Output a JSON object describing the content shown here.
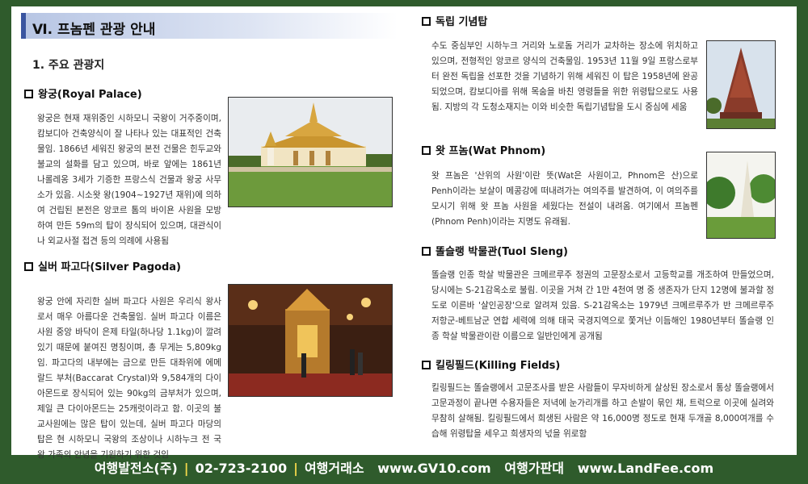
{
  "section_title": "Ⅵ. 프놈펜 관광 안내",
  "subheading": "1. 주요 관광지",
  "left": {
    "royal_palace": {
      "title": "왕궁(Royal Palace)",
      "text": "왕궁은 현재 재위중인 시하모니 국왕이 거주중이며, 캄보디아 건축양식이 잘 나타나 있는 대표적인 건축물임. 1866년 세워진 왕궁의 본전 건물은 힌두교와 불교의 설화를 담고 있으며, 바로 앞에는 1861년 나롤레옹 3세가 기증한 프랑스식 건물과 왕궁 사무소가 있음. 시소왓 왕(1904~1927년 재위)에 의하여 건립된 본전은 앙코르 톰의 바이욘 사원을 모방하여 만든 59m의 탑이 장식되어 있으며, 대관식이나 외교사절 접견 등의 의례에 사용됨"
    },
    "silver_pagoda": {
      "title": "실버 파고다(Silver Pagoda)",
      "text": "왕궁 안에 자리한 실버 파고다 사원은 우리식 왕사로서 매우 아름다운 건축물임. 실버 파고다 이름은 사원 중앙 바닥이 은제 타일(하나당 1.1kg)이 깔려있기 때문에 붙여진 명칭이며, 총 무게는 5,809kg임. 파고다의 내부에는 금으로 만든 대좌위에 에메랄드 부처(Baccarat Crystal)와 9,584개의 다이아몬드로 장식되어 있는 90kg의 금부처가 있으며, 제일 큰 다이아몬드는 25캐럿이라고 함. 이곳의 불교사원에는 많은 탑이 있는데, 실버 파고다 마당의 탑은 현 시하모니 국왕의 조상이나 시하누크 전 국왕 가족의 안녕을 기원하기 위한 것임"
    }
  },
  "right": {
    "independence": {
      "title": "독립 기념탑",
      "text": "수도 중심부인 시하누크 거리와 노로돔 거리가 교차하는 장소에 위치하고 있으며, 전형적인 앙코르 양식의 건축물임. 1953년 11월 9일 프랑스로부터 완전 독립을 선포한 것을 기념하기 위해 세워진 이 탑은 1958년에 완공되었으며, 캄보디아를 위해 목숨을 바친 영령들을 위한 위령탑으로도 사용됨. 지방의 각 도청소재지는 이와 비슷한 독립기념탑을 도시 중심에 세움"
    },
    "wat_phnom": {
      "title": "왓 프놈(Wat Phnom)",
      "text": "왓 프놈은 '산위의 사원'이란 뜻(Wat은 사원이고, Phnom은 산)으로 Penh이라는 보살이 메콩강에 떠내려가는 여의주를 발견하여, 이 여의주를 모시기 위해 왓 프놈 사원을 세웠다는 전설이 내려옴. 여기에서 프놈펜(Phnom Penh)이라는 지명도 유래됨."
    },
    "tuol_sleng": {
      "title": "똘슬랭 박물관(Tuol Sleng)",
      "text": "똘슬랭 인종 학살 박물관은 크메르루주 정권의 고문장소로서 고등학교를 개조하여 만들었으며, 당시에는 S-21감옥소로 불림. 이곳을 거쳐 간 1만 4천여 명 중 생존자가 단지 12명에 불과할 정도로 이른바 '살인공장'으로 알려져 있음. S-21감옥소는 1979년 크메르루주가 반 크메르루주 저항군-베트남군 연합 세력에 의해 태국 국경지역으로 쫓겨난 이듬해인 1980년부터 똘슬랭 인종 학살 박물관이란 이름으로 일반인에게 공개됨"
    },
    "killing_fields": {
      "title": "킬링필드(Killing Fields)",
      "text": "킬링필드는 똘슬랭에서 고문조사를 받은 사람들이 무자비하게 살상된 장소로서 통상 똘슬랭에서 고문과정이 끝나면 수용자들은 저녁에 눈가리개를 하고 손발이 묶인 채, 트럭으로 이곳에 실려와 무참히 살해됨. 킬링필드에서 희생된 사람은 약 16,000명 정도로 현재 두개골 8,000여개를 수습해 위령탑을 세우고 희생자의 넋을 위로함"
    }
  },
  "footer": {
    "company": "여행발전소(주)",
    "phone": "02-723-2100",
    "exchange_label": "여행거래소",
    "exchange_url": "www.GV10.com",
    "market_label": "여행가판대",
    "market_url": "www.LandFee.com"
  },
  "colors": {
    "frame": "#2f5b2c",
    "accent_separator": "#f2d74a",
    "header_bar": "#b8c6e4"
  }
}
